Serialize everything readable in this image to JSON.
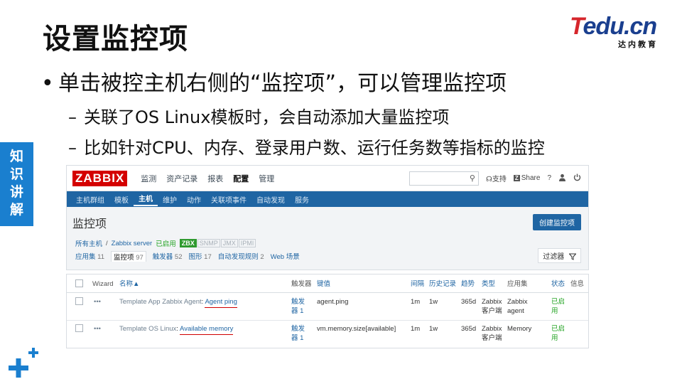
{
  "slide": {
    "title": "设置监控项",
    "logo_main": "Tedu.cn",
    "logo_sub": "达内教育",
    "bullet": "单击被控主机右侧的“监控项”，可以管理监控项",
    "sub_bullets": [
      "关联了OS Linux模板时，会自动添加大量监控项",
      "比如针对CPU、内存、登录用户数、运行任务数等指标的监控"
    ],
    "side_tag": [
      "知",
      "识",
      "讲",
      "解"
    ]
  },
  "zabbix": {
    "logo": "ZABBIX",
    "top_nav": [
      "监测",
      "资产记录",
      "报表",
      "配置",
      "管理"
    ],
    "top_nav_active": "配置",
    "top_right": {
      "support": "支持",
      "share": "Share",
      "share_box": "Z",
      "help": "?"
    },
    "sub_nav": [
      "主机群组",
      "模板",
      "主机",
      "维护",
      "动作",
      "关联项事件",
      "自动发现",
      "服务"
    ],
    "sub_nav_active": "主机",
    "page_title": "监控项",
    "create_button": "创建监控项",
    "breadcrumb": {
      "all_hosts": "所有主机",
      "sep": "/",
      "host": "Zabbix server",
      "status": "已启用",
      "tags": [
        "ZBX",
        "SNMP",
        "JMX",
        "IPMI"
      ]
    },
    "tabs": [
      {
        "label": "应用集",
        "count": "11"
      },
      {
        "label": "监控项",
        "count": "97"
      },
      {
        "label": "触发器",
        "count": "52"
      },
      {
        "label": "图形",
        "count": "17"
      },
      {
        "label": "自动发现规则",
        "count": "2"
      },
      {
        "label": "Web 场景",
        "count": ""
      }
    ],
    "filter_label": "过滤器",
    "table": {
      "headers": {
        "wizard": "Wizard",
        "name": "名称▲",
        "triggers": "触发器",
        "key": "键值",
        "interval": "间隔",
        "history": "历史记录",
        "trends": "趋势",
        "type": "类型",
        "application": "应用集",
        "status": "状态",
        "info": "信息"
      },
      "rows": [
        {
          "menu": "•••",
          "template": "Template App Zabbix Agent",
          "sep": ":",
          "name": "Agent ping",
          "triggers_l1": "触发",
          "triggers_l2": "器 1",
          "key": "agent.ping",
          "interval": "1m",
          "history": "1w",
          "trends": "365d",
          "type_l1": "Zabbix",
          "type_l2": "客户端",
          "app_l1": "Zabbix",
          "app_l2": "agent",
          "status_l1": "已启",
          "status_l2": "用"
        },
        {
          "menu": "•••",
          "template": "Template OS Linux",
          "sep": ":",
          "name": "Available memory",
          "triggers_l1": "触发",
          "triggers_l2": "器 1",
          "key": "vm.memory.size[available]",
          "interval": "1m",
          "history": "1w",
          "trends": "365d",
          "type_l1": "Zabbix",
          "type_l2": "客户端",
          "app_l1": "Memory",
          "app_l2": "",
          "status_l1": "已启",
          "status_l2": "用"
        }
      ]
    }
  },
  "colors": {
    "accent_blue": "#1a7fcf",
    "zabbix_red": "#d40000",
    "zabbix_nav": "#1f65a3",
    "enabled_green": "#22a322",
    "annotation_red": "#d00000"
  }
}
